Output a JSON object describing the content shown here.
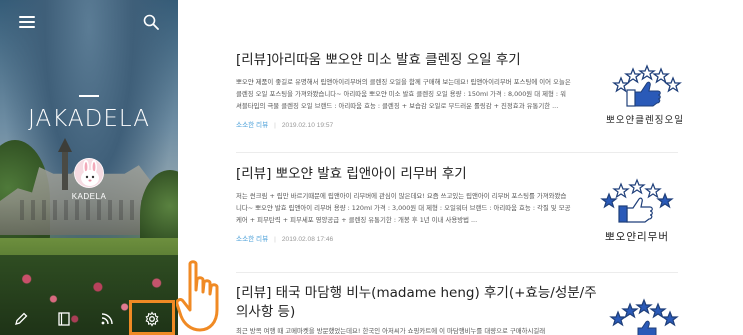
{
  "sidebar": {
    "blog_title": "JAKADELA",
    "profile_name": "KADELA",
    "icons": {
      "menu": "menu-icon",
      "search": "search-icon",
      "write": "pencil-icon",
      "guestbook": "book-icon",
      "rss": "rss-icon",
      "settings": "gear-icon"
    },
    "highlight_color": "#f08a24"
  },
  "posts": [
    {
      "title": "[리뷰]아리따움 뽀오얀 미소 발효 클렌징 오일 후기",
      "excerpt": "뽀오얀 제품이 좋길로 유명해서 립앤아이리무버의 클렌징 오일을 함께 구매해 보는데요! 립앤아이리무버 포스팅에 이어 오늘은 클렌징 오일 포스팅을 가져와봤습니다~ 아리따움 뽀오얀 미소 발효 클렌징 오일 용량 : 150ml 가격 : 8,000원 대 제형 : 워셔블타입의 극물 클렌징 오일 브랜드 : 아리따움 효능 : 클렌징 + 보습감 오일로 부드러운 롤링감 + 진정효과 유통기한 ...",
      "category": "소소한 리뷰",
      "date": "2019.02.10 19:57",
      "thumb_caption": "뽀오얀클렌징오일"
    },
    {
      "title": "[리뷰] 뽀오얀 발효 립앤아이 리무버 후기",
      "excerpt": "저는 썬크림 + 립만 바르기때문에 립앤아이 리무버에 관심이 많은데요! 요즘 쓰고있는 립앤아이 리무버 포스팅를 가져와봤습니다~ 뽀오얀 발효 립앤아이 리무버 용량 : 120ml 가격 : 3,000원 대 제형 : 오일워터 브랜드 : 아리따움 효능 : 각질 및 모공케어 + 피부탄력 + 피부세포 영양공급 + 클렌징 유통기한 : 개봉 후 1년 이내 사용방법 ...",
      "category": "소소한 리뷰",
      "date": "2019.02.08 17:46",
      "thumb_caption": "뽀오얀리무버"
    },
    {
      "title": "[리뷰] 태국 마담행 비누(madame heng) 후기(+효능/성분/주의사항 등)",
      "excerpt": "최근 방콕 여행 때 고메마켓을 방문했었는데요! 한국인 아저씨가 쇼핑카트에 이 마담행비누를 대량으로 구매하시길래",
      "category": "",
      "date": "",
      "thumb_caption": ""
    }
  ]
}
